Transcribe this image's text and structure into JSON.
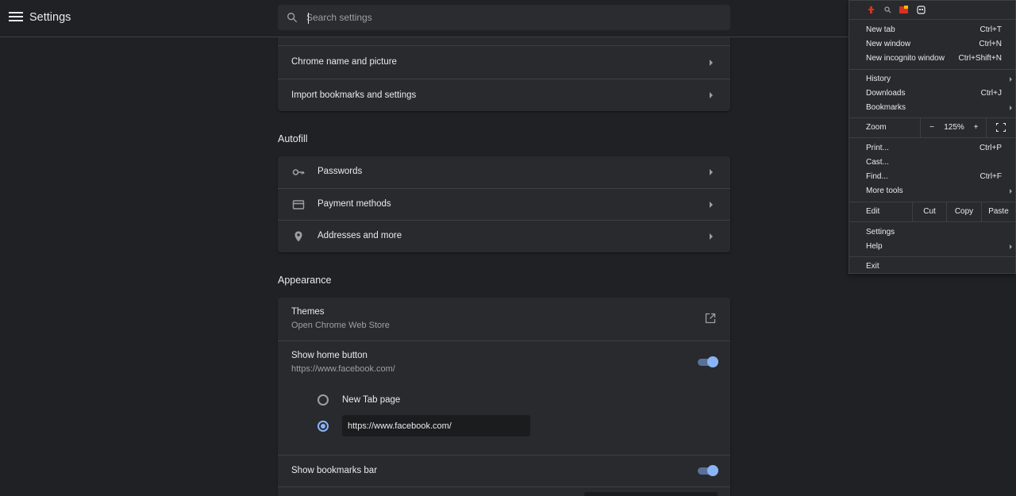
{
  "header": {
    "title": "Settings",
    "search_placeholder": "Search settings"
  },
  "people_card": {
    "rows": [
      {
        "label": "Chrome name and picture"
      },
      {
        "label": "Import bookmarks and settings"
      }
    ]
  },
  "autofill": {
    "title": "Autofill",
    "rows": [
      {
        "label": "Passwords",
        "icon": "key-icon"
      },
      {
        "label": "Payment methods",
        "icon": "credit-card-icon"
      },
      {
        "label": "Addresses and more",
        "icon": "location-pin-icon"
      }
    ]
  },
  "appearance": {
    "title": "Appearance",
    "themes": {
      "label": "Themes",
      "sub": "Open Chrome Web Store"
    },
    "home_button": {
      "label": "Show home button",
      "sub": "https://www.facebook.com/",
      "enabled": true,
      "option_new_tab": "New Tab page",
      "custom_url": "https://www.facebook.com/",
      "selected": "custom"
    },
    "bookmarks_bar": {
      "label": "Show bookmarks bar",
      "enabled": true
    }
  },
  "chrome_menu": {
    "items_top": [
      {
        "label": "New tab",
        "key": "Ctrl+T"
      },
      {
        "label": "New window",
        "key": "Ctrl+N"
      },
      {
        "label": "New incognito window",
        "key": "Ctrl+Shift+N"
      }
    ],
    "items_mid": [
      {
        "label": "History",
        "key": ""
      },
      {
        "label": "Downloads",
        "key": "Ctrl+J"
      },
      {
        "label": "Bookmarks",
        "key": ""
      }
    ],
    "zoom": {
      "label": "Zoom",
      "minus": "−",
      "value": "125%",
      "plus": "+"
    },
    "items_tools": [
      {
        "label": "Print...",
        "key": "Ctrl+P"
      },
      {
        "label": "Cast...",
        "key": ""
      },
      {
        "label": "Find...",
        "key": "Ctrl+F"
      },
      {
        "label": "More tools",
        "key": ""
      }
    ],
    "edit": {
      "label": "Edit",
      "cut": "Cut",
      "copy": "Copy",
      "paste": "Paste"
    },
    "items_bottom": [
      {
        "label": "Settings"
      },
      {
        "label": "Help"
      }
    ],
    "exit": "Exit"
  },
  "colors": {
    "background": "#202124",
    "card": "#292a2d",
    "accent": "#8ab4f8",
    "text": "#e8eaed",
    "secondary_text": "#9aa0a6"
  }
}
